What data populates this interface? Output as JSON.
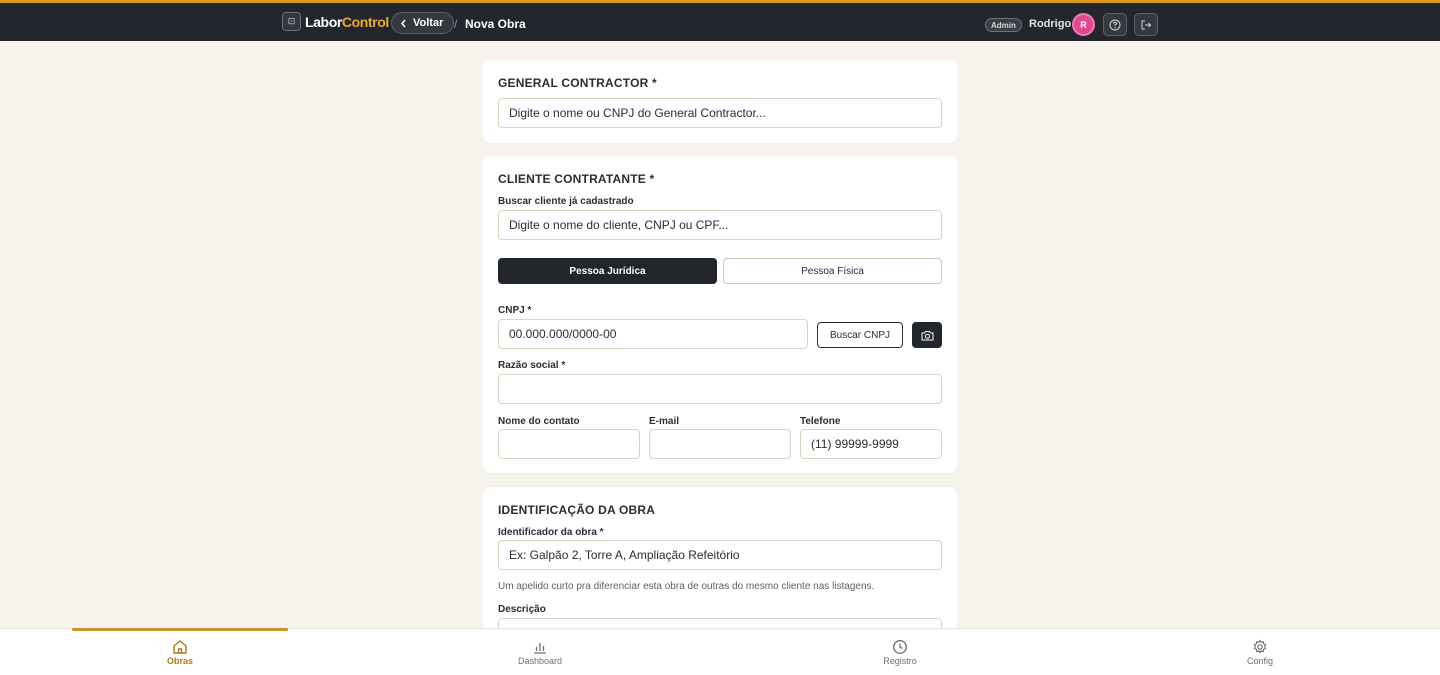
{
  "header": {
    "brand_a": "Labor",
    "brand_b": "Control",
    "back_label": "Voltar",
    "breadcrumb_sep": "/",
    "page_title": "Nova Obra",
    "role_badge": "Admin",
    "user_name": "Rodrigo",
    "avatar_initial": "R",
    "accent_color": "#d69a1e"
  },
  "general_contractor": {
    "title": "GENERAL CONTRACTOR *",
    "placeholder": "Digite o nome ou CNPJ do General Contractor..."
  },
  "cliente": {
    "title": "CLIENTE CONTRATANTE *",
    "search_label": "Buscar cliente já cadastrado",
    "search_placeholder": "Digite o nome do cliente, CNPJ ou CPF...",
    "segment_pj": "Pessoa Jurídica",
    "segment_pf": "Pessoa Física",
    "cnpj_label": "CNPJ *",
    "cnpj_placeholder": "00.000.000/0000-00",
    "buscar_cnpj": "Buscar CNPJ",
    "razao_label": "Razão social *",
    "razao_value": "",
    "contato_label": "Nome do contato",
    "contato_value": "",
    "email_label": "E-mail",
    "email_value": "",
    "telefone_label": "Telefone",
    "telefone_placeholder": "(11) 99999-9999"
  },
  "obra": {
    "title": "IDENTIFICAÇÃO DA OBRA",
    "id_label": "Identificador da obra *",
    "id_placeholder": "Ex: Galpão 2, Torre A, Ampliação Refeitório",
    "helper": "Um apelido curto pra diferenciar esta obra de outras do mesmo cliente nas listagens.",
    "desc_label": "Descrição"
  },
  "bottom_nav": [
    {
      "label": "Obras",
      "icon": "home-icon",
      "active": true
    },
    {
      "label": "Dashboard",
      "icon": "bar-chart-icon",
      "active": false
    },
    {
      "label": "Registro",
      "icon": "clock-icon",
      "active": false
    },
    {
      "label": "Config",
      "icon": "gear-icon",
      "active": false
    }
  ]
}
